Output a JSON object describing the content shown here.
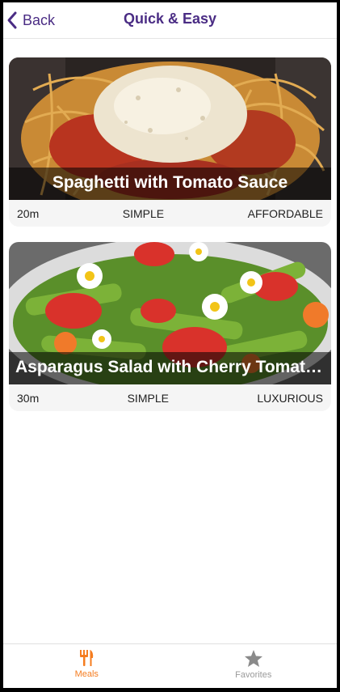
{
  "header": {
    "back_label": "Back",
    "title": "Quick & Easy"
  },
  "meals": [
    {
      "title": "Spaghetti with Tomato Sauce",
      "duration": "20m",
      "complexity": "SIMPLE",
      "affordability": "AFFORDABLE"
    },
    {
      "title": "Asparagus Salad with Cherry Tomatoes",
      "duration": "30m",
      "complexity": "SIMPLE",
      "affordability": "LUXURIOUS"
    }
  ],
  "tabs": [
    {
      "label": "Meals",
      "icon": "utensils-icon",
      "active": true
    },
    {
      "label": "Favorites",
      "icon": "star-icon",
      "active": false
    }
  ],
  "colors": {
    "accent_purple": "#4a2c84",
    "active_tab_orange": "#f57c1f",
    "inactive_tab_gray": "#9a9a9a"
  }
}
